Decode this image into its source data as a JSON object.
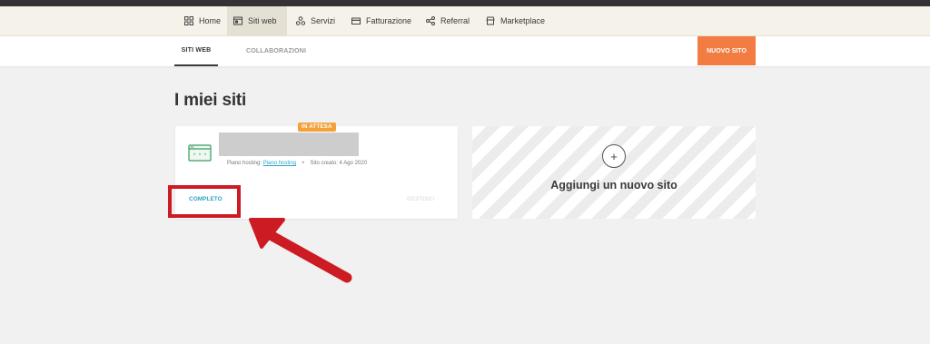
{
  "nav": {
    "items": [
      {
        "label": "Home",
        "icon": "grid-icon"
      },
      {
        "label": "Siti web",
        "icon": "browser-icon",
        "active": true
      },
      {
        "label": "Servizi",
        "icon": "services-icon"
      },
      {
        "label": "Fatturazione",
        "icon": "card-icon"
      },
      {
        "label": "Referral",
        "icon": "share-icon"
      },
      {
        "label": "Marketplace",
        "icon": "store-icon"
      }
    ]
  },
  "subnav": {
    "tabs": [
      {
        "label": "SITI WEB",
        "active": true
      },
      {
        "label": "COLLABORAZIONI"
      }
    ],
    "new_site_label": "NUOVO SITO"
  },
  "page": {
    "title": "I miei siti"
  },
  "site_card": {
    "badge": "IN ATTESA",
    "plan_prefix": "Piano hosting:",
    "plan_link": "Piano hosting",
    "created": "Sito creato: 4 Ago 2020",
    "complete_label": "COMPLETO",
    "manage_label": "GESTISCI"
  },
  "add_card": {
    "plus": "+",
    "label": "Aggiungi un nuovo sito"
  },
  "colors": {
    "accent_orange": "#f27c42",
    "badge_orange": "#f3a23a",
    "link_blue": "#2aa6c9",
    "annotation_red": "#cc1b22"
  }
}
